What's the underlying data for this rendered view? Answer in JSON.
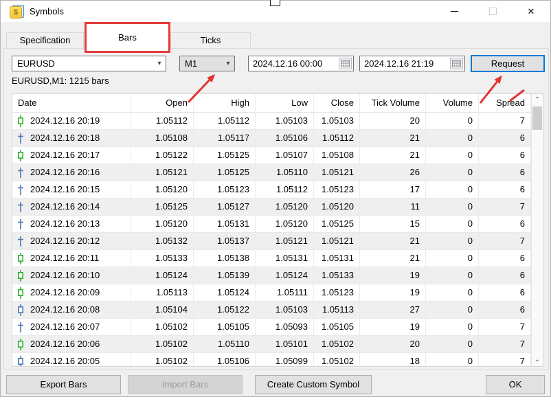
{
  "window": {
    "title": "Symbols",
    "icon_glyph": "$",
    "controls": {
      "minimize": "minimize",
      "maximize": "maximize",
      "close": "✕"
    }
  },
  "tabs": {
    "specification": "Specification",
    "bars": "Bars",
    "ticks": "Ticks"
  },
  "toolbar": {
    "symbol": "EURUSD",
    "timeframe": "M1",
    "date_from": "2024.12.16 00:00",
    "date_to": "2024.12.16 21:19",
    "request": "Request"
  },
  "summary": "EURUSD,M1: 1215 bars",
  "table": {
    "columns": [
      "Date",
      "Open",
      "High",
      "Low",
      "Close",
      "Tick Volume",
      "Volume",
      "Spread"
    ],
    "rows": [
      {
        "icon": "candle-up-green",
        "date": "2024.12.16 20:19",
        "open": "1.05112",
        "high": "1.05112",
        "low": "1.05103",
        "close": "1.05103",
        "tick_volume": "20",
        "volume": "0",
        "spread": "7"
      },
      {
        "icon": "doji-cross-blue",
        "date": "2024.12.16 20:18",
        "open": "1.05108",
        "high": "1.05117",
        "low": "1.05106",
        "close": "1.05112",
        "tick_volume": "21",
        "volume": "0",
        "spread": "6"
      },
      {
        "icon": "candle-up-green",
        "date": "2024.12.16 20:17",
        "open": "1.05122",
        "high": "1.05125",
        "low": "1.05107",
        "close": "1.05108",
        "tick_volume": "21",
        "volume": "0",
        "spread": "6"
      },
      {
        "icon": "doji-cross-blue",
        "date": "2024.12.16 20:16",
        "open": "1.05121",
        "high": "1.05125",
        "low": "1.05110",
        "close": "1.05121",
        "tick_volume": "26",
        "volume": "0",
        "spread": "6"
      },
      {
        "icon": "doji-cross-blue",
        "date": "2024.12.16 20:15",
        "open": "1.05120",
        "high": "1.05123",
        "low": "1.05112",
        "close": "1.05123",
        "tick_volume": "17",
        "volume": "0",
        "spread": "6"
      },
      {
        "icon": "doji-cross-blue",
        "date": "2024.12.16 20:14",
        "open": "1.05125",
        "high": "1.05127",
        "low": "1.05120",
        "close": "1.05120",
        "tick_volume": "11",
        "volume": "0",
        "spread": "7"
      },
      {
        "icon": "doji-cross-blue",
        "date": "2024.12.16 20:13",
        "open": "1.05120",
        "high": "1.05131",
        "low": "1.05120",
        "close": "1.05125",
        "tick_volume": "15",
        "volume": "0",
        "spread": "6"
      },
      {
        "icon": "doji-cross-blue",
        "date": "2024.12.16 20:12",
        "open": "1.05132",
        "high": "1.05137",
        "low": "1.05121",
        "close": "1.05121",
        "tick_volume": "21",
        "volume": "0",
        "spread": "7"
      },
      {
        "icon": "candle-up-green",
        "date": "2024.12.16 20:11",
        "open": "1.05133",
        "high": "1.05138",
        "low": "1.05131",
        "close": "1.05131",
        "tick_volume": "21",
        "volume": "0",
        "spread": "6"
      },
      {
        "icon": "candle-up-green",
        "date": "2024.12.16 20:10",
        "open": "1.05124",
        "high": "1.05139",
        "low": "1.05124",
        "close": "1.05133",
        "tick_volume": "19",
        "volume": "0",
        "spread": "6"
      },
      {
        "icon": "candle-up-green",
        "date": "2024.12.16 20:09",
        "open": "1.05113",
        "high": "1.05124",
        "low": "1.05111",
        "close": "1.05123",
        "tick_volume": "19",
        "volume": "0",
        "spread": "6"
      },
      {
        "icon": "candle-down-blue",
        "date": "2024.12.16 20:08",
        "open": "1.05104",
        "high": "1.05122",
        "low": "1.05103",
        "close": "1.05113",
        "tick_volume": "27",
        "volume": "0",
        "spread": "6"
      },
      {
        "icon": "doji-cross-blue",
        "date": "2024.12.16 20:07",
        "open": "1.05102",
        "high": "1.05105",
        "low": "1.05093",
        "close": "1.05105",
        "tick_volume": "19",
        "volume": "0",
        "spread": "7"
      },
      {
        "icon": "candle-up-green",
        "date": "2024.12.16 20:06",
        "open": "1.05102",
        "high": "1.05110",
        "low": "1.05101",
        "close": "1.05102",
        "tick_volume": "20",
        "volume": "0",
        "spread": "7"
      },
      {
        "icon": "candle-down-blue",
        "date": "2024.12.16 20:05",
        "open": "1.05102",
        "high": "1.05106",
        "low": "1.05099",
        "close": "1.05102",
        "tick_volume": "18",
        "volume": "0",
        "spread": "7"
      }
    ]
  },
  "footer": {
    "export": "Export Bars",
    "import": "Import Bars",
    "create": "Create Custom Symbol",
    "ok": "OK"
  },
  "annotations": {
    "box_target": "bars-tab",
    "arrow_targets": [
      "timeframe-combo",
      "request-button"
    ],
    "color": "#e23333"
  },
  "colors": {
    "accent_blue": "#0078d7",
    "annotation_red": "#e23333",
    "candle_green": "#2db32d",
    "candle_blue": "#4a78b5",
    "dialog_bg": "#f0f0f0"
  }
}
